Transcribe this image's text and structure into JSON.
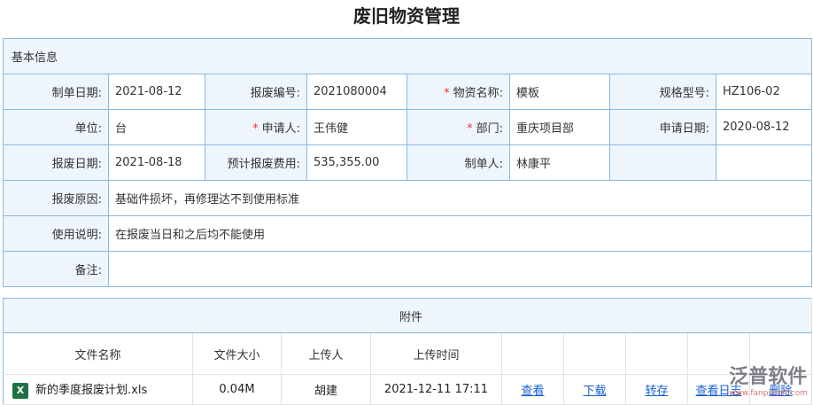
{
  "title": "废旧物资管理",
  "basic": {
    "section": "基本信息",
    "rows": [
      [
        {
          "l": "制单日期:",
          "v": "2021-08-12"
        },
        {
          "l": "报废编号:",
          "v": "2021080004"
        },
        {
          "l": "物资名称:",
          "v": "模板",
          "req": true
        },
        {
          "l": "规格型号:",
          "v": "HZ106-02"
        }
      ],
      [
        {
          "l": "单位:",
          "v": "台"
        },
        {
          "l": "申请人:",
          "v": "王伟健",
          "req": true
        },
        {
          "l": "部门:",
          "v": "重庆项目部",
          "req": true
        },
        {
          "l": "申请日期:",
          "v": "2020-08-12"
        }
      ],
      [
        {
          "l": "报废日期:",
          "v": "2021-08-18"
        },
        {
          "l": "预计报废费用:",
          "v": "535,355.00"
        },
        {
          "l": "制单人:",
          "v": "林康平"
        },
        {
          "l": "",
          "v": ""
        }
      ]
    ],
    "wide": [
      {
        "l": "报废原因:",
        "v": "基础件损坏，再修理达不到使用标准"
      },
      {
        "l": "使用说明:",
        "v": "在报废当日和之后均不能使用"
      },
      {
        "l": "备注:",
        "v": ""
      }
    ]
  },
  "attachments": {
    "section": "附件",
    "headers": [
      "文件名称",
      "文件大小",
      "上传人",
      "上传时间"
    ],
    "files": [
      {
        "name": "新的季度报废计划.xls",
        "size": "0.04M",
        "uploader": "胡建",
        "time": "2021-12-11 17:11",
        "actions": [
          "查看",
          "下载",
          "转存",
          "查看日志",
          "删除"
        ]
      }
    ]
  },
  "watermark": {
    "text": "泛普软件",
    "url": "www.fanpusoft.com"
  }
}
